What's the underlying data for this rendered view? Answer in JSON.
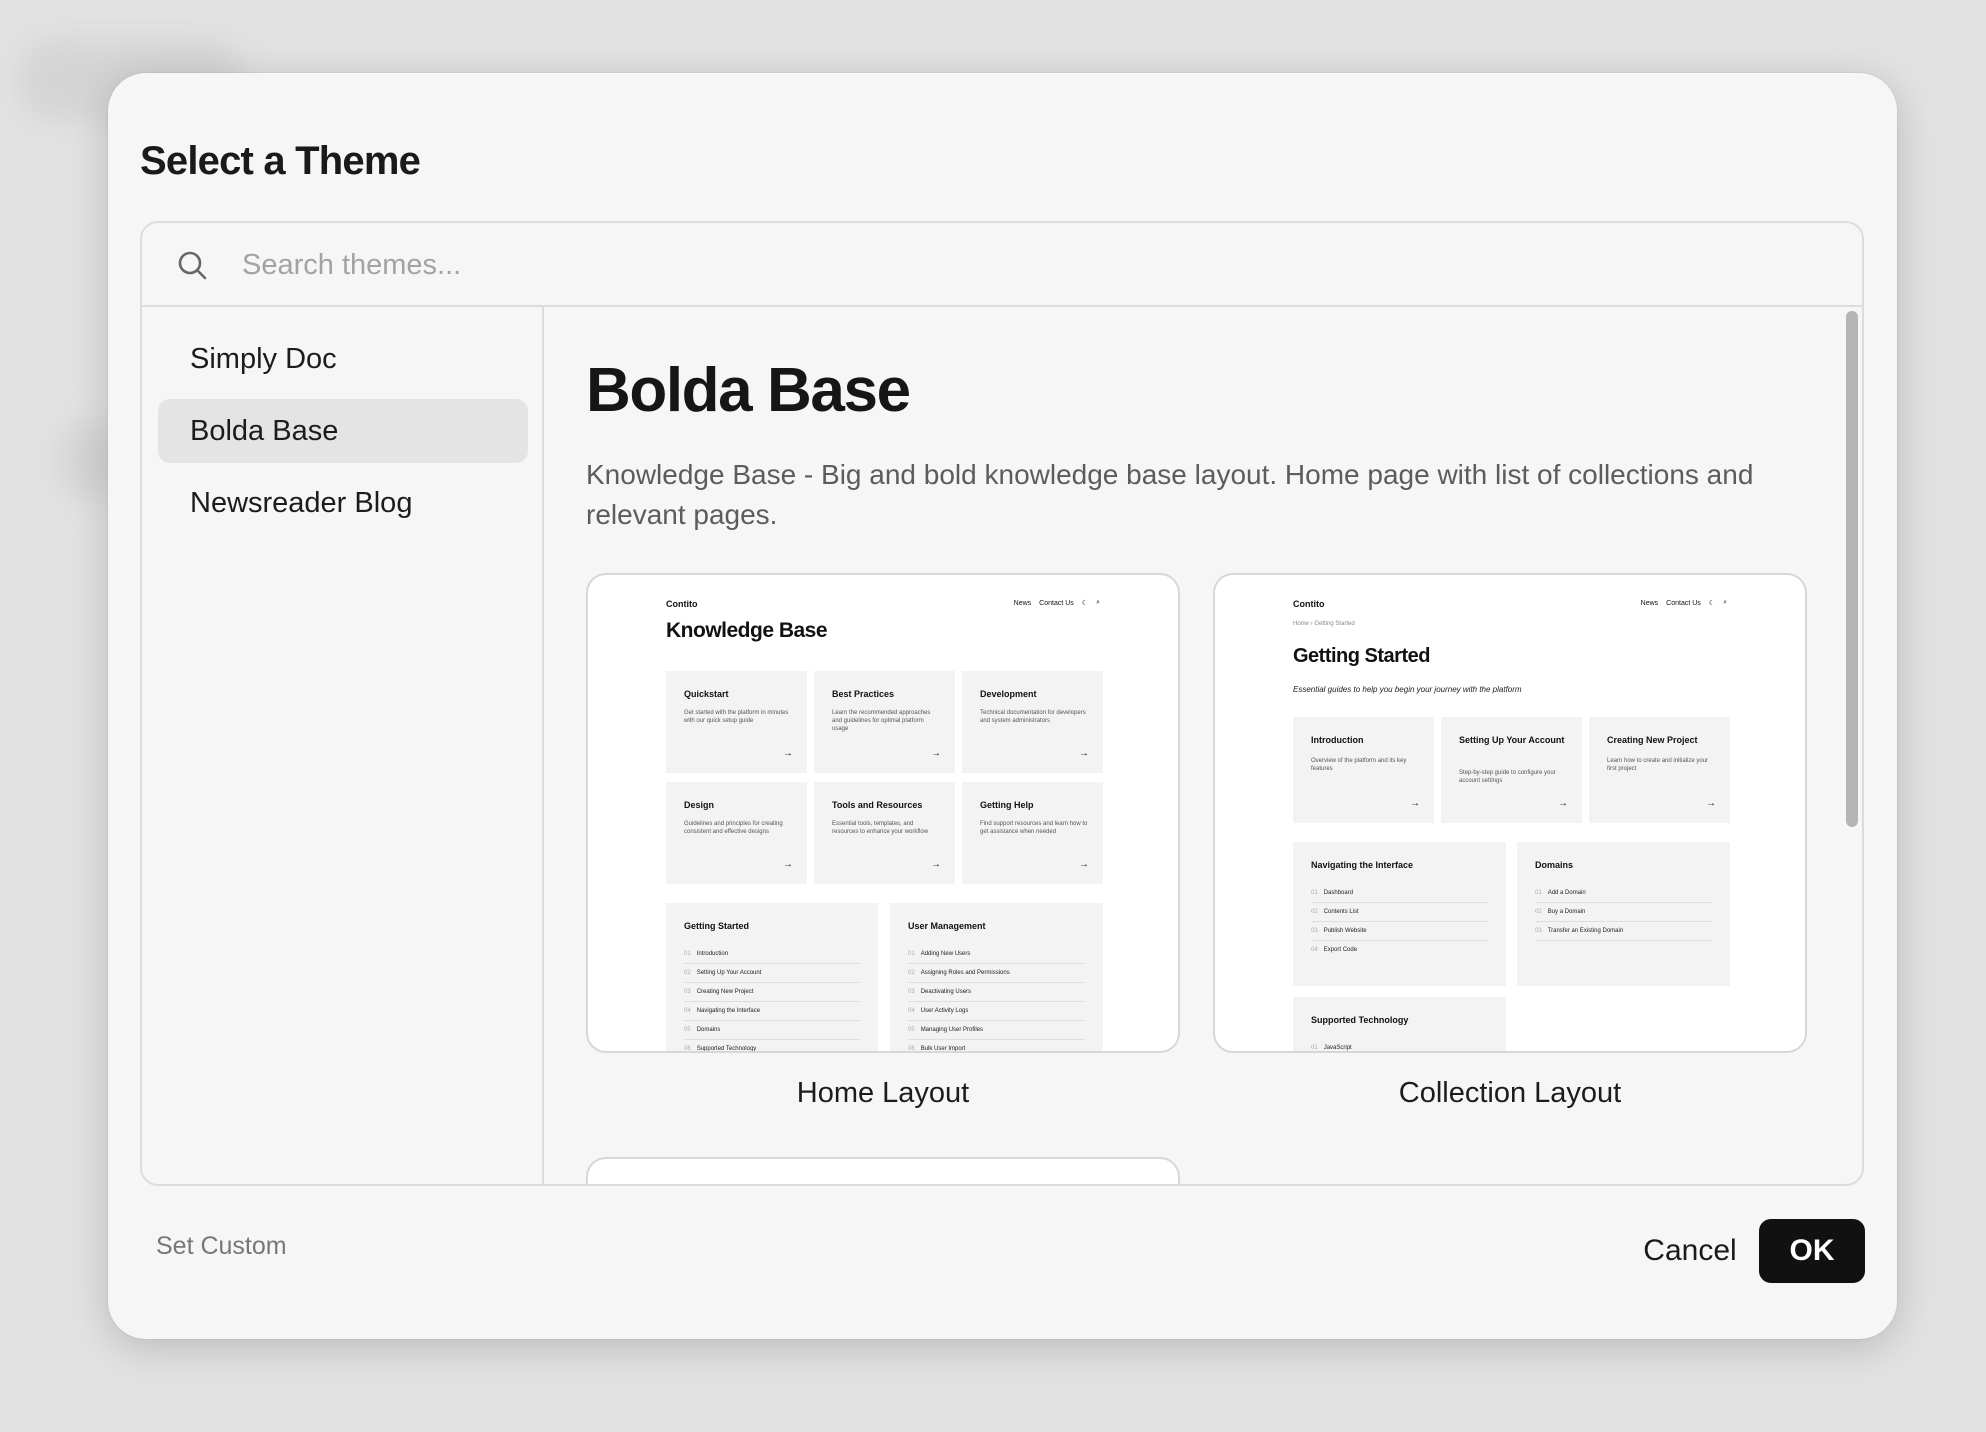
{
  "dialog": {
    "title": "Select a Theme"
  },
  "search": {
    "placeholder": "Search themes..."
  },
  "sidebar": {
    "items": [
      {
        "label": "Simply Doc",
        "active": false
      },
      {
        "label": "Bolda Base",
        "active": true
      },
      {
        "label": "Newsreader Blog",
        "active": false
      }
    ]
  },
  "theme": {
    "name": "Bolda Base",
    "description": "Knowledge Base - Big and bold knowledge base layout. Home page with list of collections and relevant pages."
  },
  "layouts": [
    {
      "label": "Home Layout",
      "preview": {
        "brand": "Contito",
        "nav": [
          "News",
          "Contact Us"
        ],
        "heading": "Knowledge Base",
        "tiles": [
          {
            "title": "Quickstart",
            "desc": "Get started with the platform in minutes with our quick setup guide"
          },
          {
            "title": "Best Practices",
            "desc": "Learn the recommended approaches and guidelines for optimal platform usage"
          },
          {
            "title": "Development",
            "desc": "Technical documentation for developers and system administrators"
          },
          {
            "title": "Design",
            "desc": "Guidelines and principles for creating consistent and effective designs"
          },
          {
            "title": "Tools and Resources",
            "desc": "Essential tools, templates, and resources to enhance your workflow"
          },
          {
            "title": "Getting Help",
            "desc": "Find support resources and learn how to get assistance when needed"
          }
        ],
        "lists": [
          {
            "title": "Getting Started",
            "items": [
              "Introduction",
              "Setting Up Your Account",
              "Creating New Project",
              "Navigating the Interface",
              "Domains",
              "Supported Technology"
            ]
          },
          {
            "title": "User Management",
            "items": [
              "Adding New Users",
              "Assigning Roles and Permissions",
              "Deactivating Users",
              "User Activity Logs",
              "Managing User Profiles",
              "Bulk User Import"
            ]
          }
        ]
      }
    },
    {
      "label": "Collection Layout",
      "preview": {
        "brand": "Contito",
        "nav": [
          "News",
          "Contact Us"
        ],
        "breadcrumb": "Home › Getting Started",
        "heading": "Getting Started",
        "subheading": "Essential guides to help you begin your journey with the platform",
        "tiles": [
          {
            "title": "Introduction",
            "desc": "Overview of the platform and its key features"
          },
          {
            "title": "Setting Up Your Account",
            "desc": "Step-by-step guide to configure your account settings"
          },
          {
            "title": "Creating New Project",
            "desc": "Learn how to create and initialize your first project"
          }
        ],
        "lists": [
          {
            "title": "Navigating the Interface",
            "items": [
              "Dashboard",
              "Contents List",
              "Publish Website",
              "Export Code"
            ]
          },
          {
            "title": "Domains",
            "items": [
              "Add a Domain",
              "Buy a Domain",
              "Transfer an Existing Domain"
            ]
          },
          {
            "title": "Supported Technology",
            "items": [
              "JavaScript"
            ]
          }
        ]
      }
    }
  ],
  "footer": {
    "set_custom": "Set Custom",
    "cancel": "Cancel",
    "ok": "OK"
  },
  "icons": {
    "search": "search-icon",
    "moon": "moon-icon",
    "arrow": "arrow-right-icon"
  },
  "colors": {
    "primary_button": "#111111",
    "active_item_bg": "#e4e4e4",
    "dialog_bg": "#f6f6f6"
  }
}
